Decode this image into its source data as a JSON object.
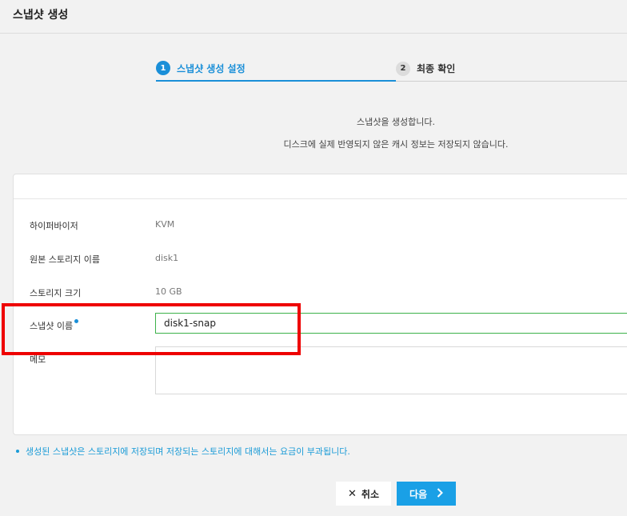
{
  "header": {
    "title": "스냅샷 생성"
  },
  "steps": [
    {
      "number": "1",
      "label": "스냅샷 생성 설정",
      "active": true
    },
    {
      "number": "2",
      "label": "최종 확인",
      "active": false
    }
  ],
  "description": {
    "line1": "스냅샷을 생성합니다.",
    "line2": "디스크에 실제 반영되지 않은 캐시 정보는 저장되지 않습니다."
  },
  "form": {
    "hypervisor": {
      "label": "하이퍼바이저",
      "value": "KVM"
    },
    "source_storage": {
      "label": "원본 스토리지 이름",
      "value": "disk1"
    },
    "storage_size": {
      "label": "스토리지 크기",
      "value": "10 GB"
    },
    "snapshot_name": {
      "label": "스냅샷 이름",
      "value": "disk1-snap",
      "required": true
    },
    "memo": {
      "label": "메모",
      "value": ""
    }
  },
  "note": "생성된 스냅샷은 스토리지에 저장되며 저장되는 스토리지에 대해서는 요금이 부과됩니다.",
  "buttons": {
    "cancel_label": "취소",
    "next_label": "다음"
  },
  "colors": {
    "accent": "#1a8fd8",
    "valid_border": "#3db24a",
    "highlight": "#ee0000",
    "note_text": "#1a9bd7"
  },
  "icons": {
    "cancel": "close-icon",
    "next": "chevron-right-icon"
  }
}
